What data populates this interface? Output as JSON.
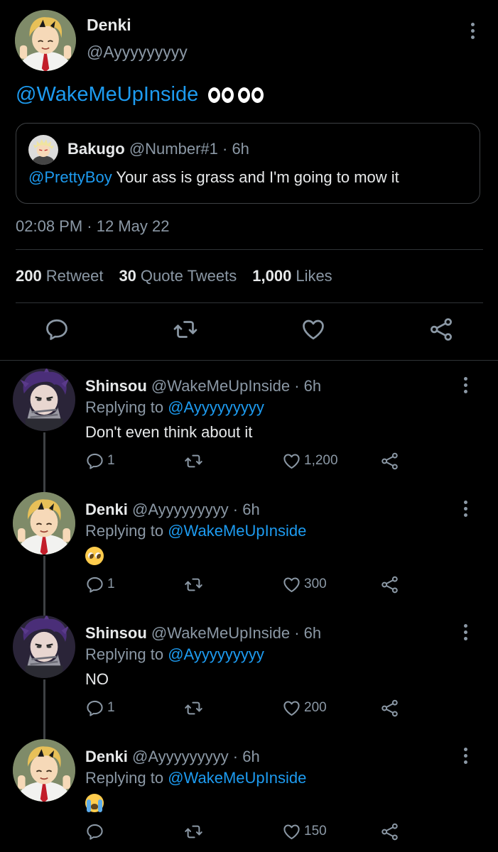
{
  "main_tweet": {
    "author_name": "Denki",
    "author_handle": "@Ayyyyyyyyy",
    "text_mention": "@WakeMeUpInside",
    "text_emoji": "eyes-emoji x2",
    "quoted": {
      "author_name": "Bakugo",
      "author_handle": "@Number#1",
      "time": "· 6h",
      "mention": "@PrettyBoy",
      "text": "Your ass is grass and I'm going to mow it"
    },
    "timestamp": "02:08 PM · 12 May 22",
    "stats": {
      "retweets_count": "200",
      "retweets_label": "Retweet",
      "quotes_count": "30",
      "quotes_label": "Quote Tweets",
      "likes_count": "1,000",
      "likes_label": "Likes"
    }
  },
  "replies": [
    {
      "author_name": "Shinsou",
      "author_handle": "@WakeMeUpInside",
      "time": "· 6h",
      "replying_prefix": "Replying to",
      "replying_to": "@Ayyyyyyyyy",
      "text": "Don't even think about it",
      "reply_count": "1",
      "like_count": "1,200"
    },
    {
      "author_name": "Denki",
      "author_handle": "@Ayyyyyyyyy",
      "time": "· 6h",
      "replying_prefix": "Replying to",
      "replying_to": "@WakeMeUpInside",
      "text": "",
      "emoji": "pleading-face-emoji",
      "reply_count": "1",
      "like_count": "300"
    },
    {
      "author_name": "Shinsou",
      "author_handle": "@WakeMeUpInside",
      "time": "· 6h",
      "replying_prefix": "Replying to",
      "replying_to": "@Ayyyyyyyyy",
      "text": "NO",
      "reply_count": "1",
      "like_count": "200"
    },
    {
      "author_name": "Denki",
      "author_handle": "@Ayyyyyyyyy",
      "time": "· 6h",
      "replying_prefix": "Replying to",
      "replying_to": "@WakeMeUpInside",
      "text": "",
      "emoji": "loudly-crying-face-emoji",
      "reply_count": "",
      "like_count": "150"
    }
  ],
  "colors": {
    "background": "#000000",
    "text": "#e7e9ea",
    "muted": "#8b98a5",
    "link": "#1d9bf0",
    "border": "#2f3336"
  },
  "icons": [
    "reply-icon",
    "retweet-icon",
    "like-icon",
    "share-icon",
    "more-options-icon"
  ]
}
